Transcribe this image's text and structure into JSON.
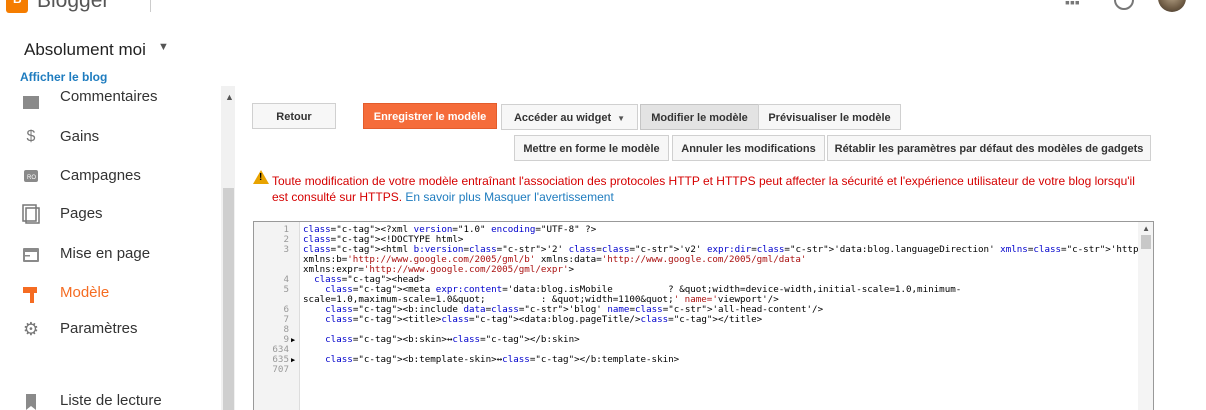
{
  "app": {
    "brand": "Blogger"
  },
  "blog": {
    "title": "Absolument moi",
    "view_link": "Afficher le blog"
  },
  "sidebar": {
    "items": [
      {
        "label": "Commentaires",
        "icon": "comment-icon",
        "active": false
      },
      {
        "label": "Gains",
        "icon": "dollar-icon",
        "active": false
      },
      {
        "label": "Campagnes",
        "icon": "ads-icon",
        "active": false
      },
      {
        "label": "Pages",
        "icon": "pages-icon",
        "active": false
      },
      {
        "label": "Mise en page",
        "icon": "layout-icon",
        "active": false
      },
      {
        "label": "Modèle",
        "icon": "template-icon",
        "active": true
      },
      {
        "label": "Paramètres",
        "icon": "gear-icon",
        "active": false
      },
      {
        "label": "Liste de lecture",
        "icon": "bookmark-icon",
        "active": false
      }
    ]
  },
  "toolbar": {
    "back": "Retour",
    "save": "Enregistrer le modèle",
    "jump_widget": "Accéder au widget",
    "edit": "Modifier le modèle",
    "preview": "Prévisualiser le modèle",
    "format": "Mettre en forme le modèle",
    "revert": "Annuler les modifications",
    "reset_gadgets": "Rétablir les paramètres par défaut des modèles de gadgets"
  },
  "warning": {
    "text": "Toute modification de votre modèle entraînant l'association des protocoles HTTP et HTTPS peut affecter la sécurité et l'expérience utilisateur de votre blog lorsqu'il est consulté sur HTTPS.",
    "learn_more": "En savoir plus",
    "dismiss": "Masquer l'avertissement"
  },
  "editor": {
    "lines": [
      {
        "n": "1",
        "fold": "",
        "code": "<?xml version=\"1.0\" encoding=\"UTF-8\" ?>"
      },
      {
        "n": "2",
        "fold": "",
        "code": "<!DOCTYPE html>"
      },
      {
        "n": "3",
        "fold": "",
        "code": "<html b:version='2' class='v2' expr:dir='data:blog.languageDirection' xmlns='http://www.w3.org/1999/xhtml'"
      },
      {
        "n": "",
        "fold": "",
        "code": "xmlns:b='http://www.google.com/2005/gml/b' xmlns:data='http://www.google.com/2005/gml/data'"
      },
      {
        "n": "",
        "fold": "",
        "code": "xmlns:expr='http://www.google.com/2005/gml/expr'>"
      },
      {
        "n": "4",
        "fold": "",
        "code": "  <head>"
      },
      {
        "n": "5",
        "fold": "",
        "code": "    <meta expr:content='data:blog.isMobile          ? &quot;width=device-width,initial-scale=1.0,minimum-"
      },
      {
        "n": "",
        "fold": "",
        "code": "scale=1.0,maximum-scale=1.0&quot;          : &quot;width=1100&quot;' name='viewport'/>"
      },
      {
        "n": "6",
        "fold": "",
        "code": "    <b:include data='blog' name='all-head-content'/>"
      },
      {
        "n": "7",
        "fold": "",
        "code": "    <title><data:blog.pageTitle/></title>"
      },
      {
        "n": "8",
        "fold": "",
        "code": ""
      },
      {
        "n": "9",
        "fold": "▶",
        "code": "    <b:skin>↔</b:skin>"
      },
      {
        "n": "634",
        "fold": "",
        "code": ""
      },
      {
        "n": "635",
        "fold": "▶",
        "code": "    <b:template-skin>↔</b:template-skin>"
      },
      {
        "n": "707",
        "fold": "",
        "code": ""
      }
    ]
  }
}
